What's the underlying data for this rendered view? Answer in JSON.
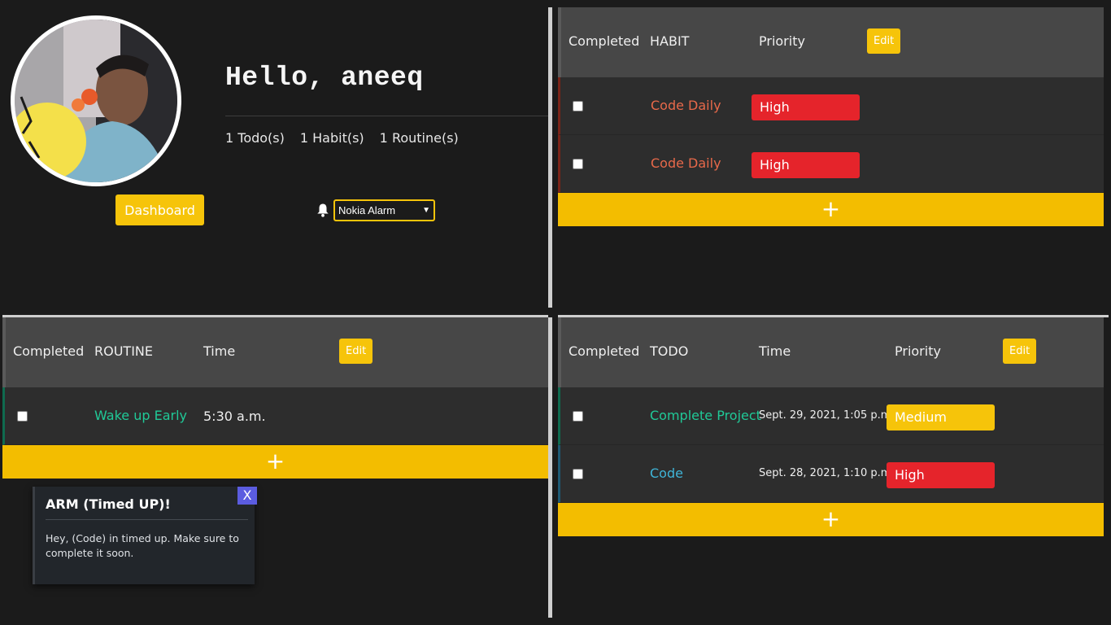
{
  "profile": {
    "greeting": "Hello, aneeq",
    "counts": [
      "1 Todo(s)",
      "1 Habit(s)",
      "1 Routine(s)"
    ],
    "dashboard_label": "Dashboard",
    "alarm_selected": "Nokia Alarm"
  },
  "habits": {
    "headers": {
      "completed": "Completed",
      "name": "HABIT",
      "priority": "Priority"
    },
    "edit_label": "Edit",
    "rows": [
      {
        "name": "Code Daily",
        "priority": "High"
      },
      {
        "name": "Code Daily",
        "priority": "High"
      }
    ],
    "add_label": "+"
  },
  "routines": {
    "headers": {
      "completed": "Completed",
      "name": "ROUTINE",
      "time": "Time"
    },
    "edit_label": "Edit",
    "rows": [
      {
        "name": "Wake up Early",
        "time": "5:30 a.m."
      }
    ],
    "add_label": "+"
  },
  "todos": {
    "headers": {
      "completed": "Completed",
      "name": "TODO",
      "time": "Time",
      "priority": "Priority"
    },
    "edit_label": "Edit",
    "rows": [
      {
        "name": "Complete Project",
        "time": "Sept. 29, 2021, 1:05 p.m.",
        "priority": "Medium"
      },
      {
        "name": "Code",
        "time": "Sept. 28, 2021, 1:10 p.m.",
        "priority": "High"
      }
    ],
    "add_label": "+"
  },
  "toast": {
    "title": "ARM (Timed UP)!",
    "message": "Hey, (Code) in timed up. Make sure to complete it soon.",
    "close_label": "X"
  },
  "colors": {
    "accent_yellow": "#f6c40a",
    "priority_high": "#e5242b",
    "priority_medium": "#f6c40a",
    "habit_text": "#e8694a",
    "routine_text": "#20c997",
    "todo_text_green": "#20c997",
    "todo_text_blue": "#3fb5d8"
  }
}
